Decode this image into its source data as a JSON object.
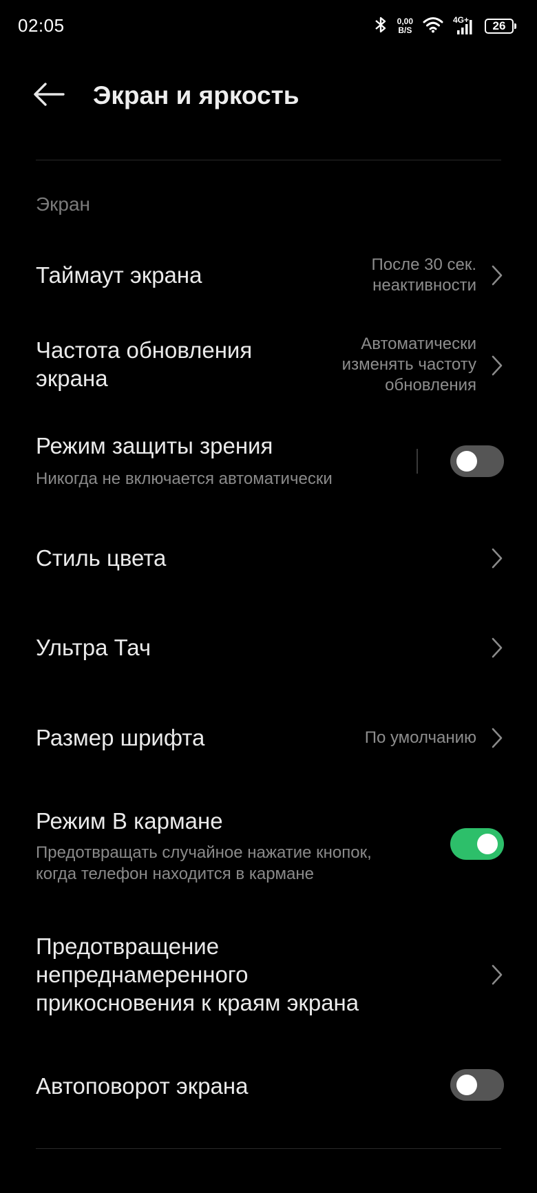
{
  "status_bar": {
    "time": "02:05",
    "net_speed_value": "0,00",
    "net_speed_unit": "B/S",
    "lte": "4G+",
    "battery": "26",
    "icons": [
      "bluetooth-icon",
      "wifi-icon",
      "signal-icon",
      "battery-icon"
    ]
  },
  "header": {
    "title": "Экран и яркость",
    "back_icon": "arrow-left-icon"
  },
  "section": {
    "label": "Экран"
  },
  "rows": {
    "timeout": {
      "title": "Таймаут экрана",
      "value_line1": "После 30 сек.",
      "value_line2": "неактивности"
    },
    "refresh_rate": {
      "title_line1": "Частота обновления",
      "title_line2": "экрана",
      "value_line1": "Автоматически",
      "value_line2": "изменять частоту",
      "value_line3": "обновления"
    },
    "eye_comfort": {
      "title": "Режим защиты зрения",
      "subtitle": "Никогда не включается автоматически",
      "enabled": false
    },
    "color_style": {
      "title": "Стиль цвета"
    },
    "ultra_touch": {
      "title": "Ультра Тач"
    },
    "font_size": {
      "title": "Размер шрифта",
      "value": "По умолчанию"
    },
    "pocket_mode": {
      "title": "Режим В кармане",
      "subtitle_line1": "Предотвращать случайное нажатие кнопок,",
      "subtitle_line2": "когда телефон находится в кармане",
      "enabled": true
    },
    "edge_touch": {
      "title_line1": "Предотвращение",
      "title_line2": "непреднамеренного",
      "title_line3": "прикосновения к краям экрана"
    },
    "auto_rotate": {
      "title": "Автоповорот экрана",
      "enabled": false
    }
  },
  "colors": {
    "background": "#000000",
    "toggle_on": "#2dbf6a",
    "toggle_off": "#555555",
    "secondary_text": "#8a8a8a"
  }
}
